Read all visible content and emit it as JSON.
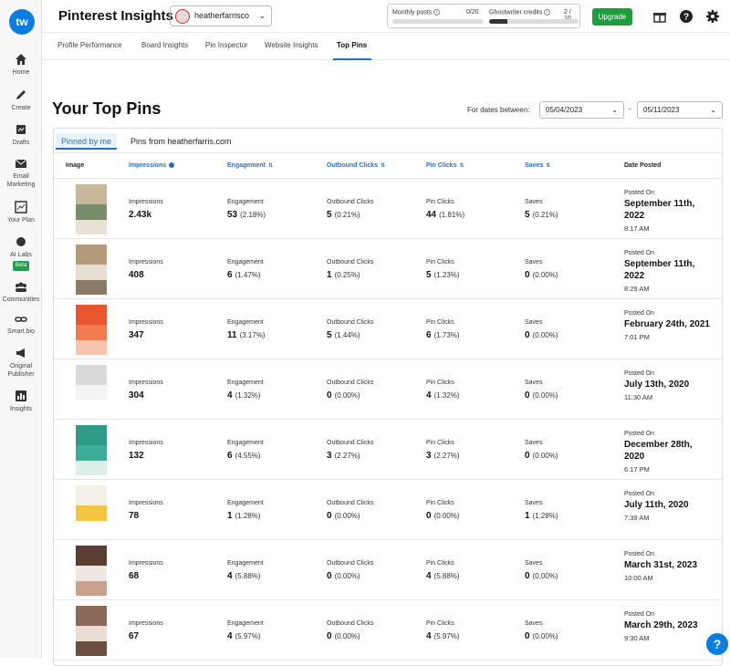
{
  "app": {
    "logo_text": "tw",
    "title": "Pinterest Insights"
  },
  "account": {
    "name": "heatherfarrisco"
  },
  "usage": {
    "monthly_posts_label": "Monthly posts",
    "monthly_posts_value": "0/20",
    "ghostwriter_label": "Ghostwriter credits",
    "ghostwriter_value": "2 / 10",
    "ghostwriter_fraction": 0.2
  },
  "header": {
    "upgrade_label": "Upgrade"
  },
  "sidebar": {
    "items": [
      {
        "label": "Home",
        "icon": "home-icon"
      },
      {
        "label": "Create",
        "icon": "pencil-icon"
      },
      {
        "label": "Drafts",
        "icon": "drafts-icon"
      },
      {
        "label": "Email Marketing",
        "icon": "email-icon"
      },
      {
        "label": "Your Plan",
        "icon": "plan-icon"
      },
      {
        "label": "AI Labs",
        "icon": "ai-labs-icon",
        "badge": "Beta"
      },
      {
        "label": "Communities",
        "icon": "communities-icon"
      },
      {
        "label": "Smart.bio",
        "icon": "link-icon"
      },
      {
        "label": "Original Publisher",
        "icon": "megaphone-icon"
      },
      {
        "label": "Insights",
        "icon": "insights-icon"
      }
    ]
  },
  "tabs": [
    "Profile Performance",
    "Board Insights",
    "Pin Inspector",
    "Website Insights",
    "Top Pins"
  ],
  "active_tab": "Top Pins",
  "main": {
    "title": "Your Top Pins",
    "date_label": "For dates between:",
    "date_from": "05/04/2023",
    "date_to": "05/11/2023",
    "date_separator": "-"
  },
  "card": {
    "tabs": [
      "Pinned by me",
      "Pins from heatherfarris.com"
    ],
    "columns": [
      "Image",
      "Impressions",
      "Engagement",
      "Outbound Clicks",
      "Pin Clicks",
      "Saves",
      "Date Posted"
    ],
    "metric_labels": [
      "Impressions",
      "Engagement",
      "Outbound Clicks",
      "Pin Clicks",
      "Saves"
    ],
    "posted_label": "Posted On"
  },
  "rows": [
    {
      "impressions": "2.43k",
      "engagement": "53",
      "engagement_pct": "(2.18%)",
      "outbound": "5",
      "outbound_pct": "(0.21%)",
      "pin_clicks": "44",
      "pin_clicks_pct": "(1.81%)",
      "saves": "5",
      "saves_pct": "(0.21%)",
      "date_line1": "September 11th,",
      "date_line2": "2022",
      "time": "8:17 AM"
    },
    {
      "impressions": "408",
      "engagement": "6",
      "engagement_pct": "(1.47%)",
      "outbound": "1",
      "outbound_pct": "(0.25%)",
      "pin_clicks": "5",
      "pin_clicks_pct": "(1.23%)",
      "saves": "0",
      "saves_pct": "(0.00%)",
      "date_line1": "September 11th,",
      "date_line2": "2022",
      "time": "8:29 AM"
    },
    {
      "impressions": "347",
      "engagement": "11",
      "engagement_pct": "(3.17%)",
      "outbound": "5",
      "outbound_pct": "(1.44%)",
      "pin_clicks": "6",
      "pin_clicks_pct": "(1.73%)",
      "saves": "0",
      "saves_pct": "(0.00%)",
      "date_line1": "February 24th, 2021",
      "date_line2": "",
      "time": "7:01 PM"
    },
    {
      "impressions": "304",
      "engagement": "4",
      "engagement_pct": "(1.32%)",
      "outbound": "0",
      "outbound_pct": "(0.00%)",
      "pin_clicks": "4",
      "pin_clicks_pct": "(1.32%)",
      "saves": "0",
      "saves_pct": "(0.00%)",
      "date_line1": "July 13th, 2020",
      "date_line2": "",
      "time": "11:30 AM"
    },
    {
      "impressions": "132",
      "engagement": "6",
      "engagement_pct": "(4.55%)",
      "outbound": "3",
      "outbound_pct": "(2.27%)",
      "pin_clicks": "3",
      "pin_clicks_pct": "(2.27%)",
      "saves": "0",
      "saves_pct": "(0.00%)",
      "date_line1": "December 28th,",
      "date_line2": "2020",
      "time": "6:17 PM"
    },
    {
      "impressions": "78",
      "engagement": "1",
      "engagement_pct": "(1.28%)",
      "outbound": "0",
      "outbound_pct": "(0.00%)",
      "pin_clicks": "0",
      "pin_clicks_pct": "(0.00%)",
      "saves": "1",
      "saves_pct": "(1.28%)",
      "date_line1": "July 11th, 2020",
      "date_line2": "",
      "time": "7:39 AM"
    },
    {
      "impressions": "68",
      "engagement": "4",
      "engagement_pct": "(5.88%)",
      "outbound": "0",
      "outbound_pct": "(0.00%)",
      "pin_clicks": "4",
      "pin_clicks_pct": "(5.88%)",
      "saves": "0",
      "saves_pct": "(0.00%)",
      "date_line1": "March 31st, 2023",
      "date_line2": "",
      "time": "10:00 AM"
    },
    {
      "impressions": "67",
      "engagement": "4",
      "engagement_pct": "(5.97%)",
      "outbound": "0",
      "outbound_pct": "(0.00%)",
      "pin_clicks": "4",
      "pin_clicks_pct": "(5.97%)",
      "saves": "0",
      "saves_pct": "(0.00%)",
      "date_line1": "March 29th, 2023",
      "date_line2": "",
      "time": "9:30 AM"
    }
  ],
  "colors": {
    "accent": "#2a6fbf",
    "upgrade": "#1e9e3e",
    "logo": "#0a7de0"
  },
  "help_label": "?"
}
